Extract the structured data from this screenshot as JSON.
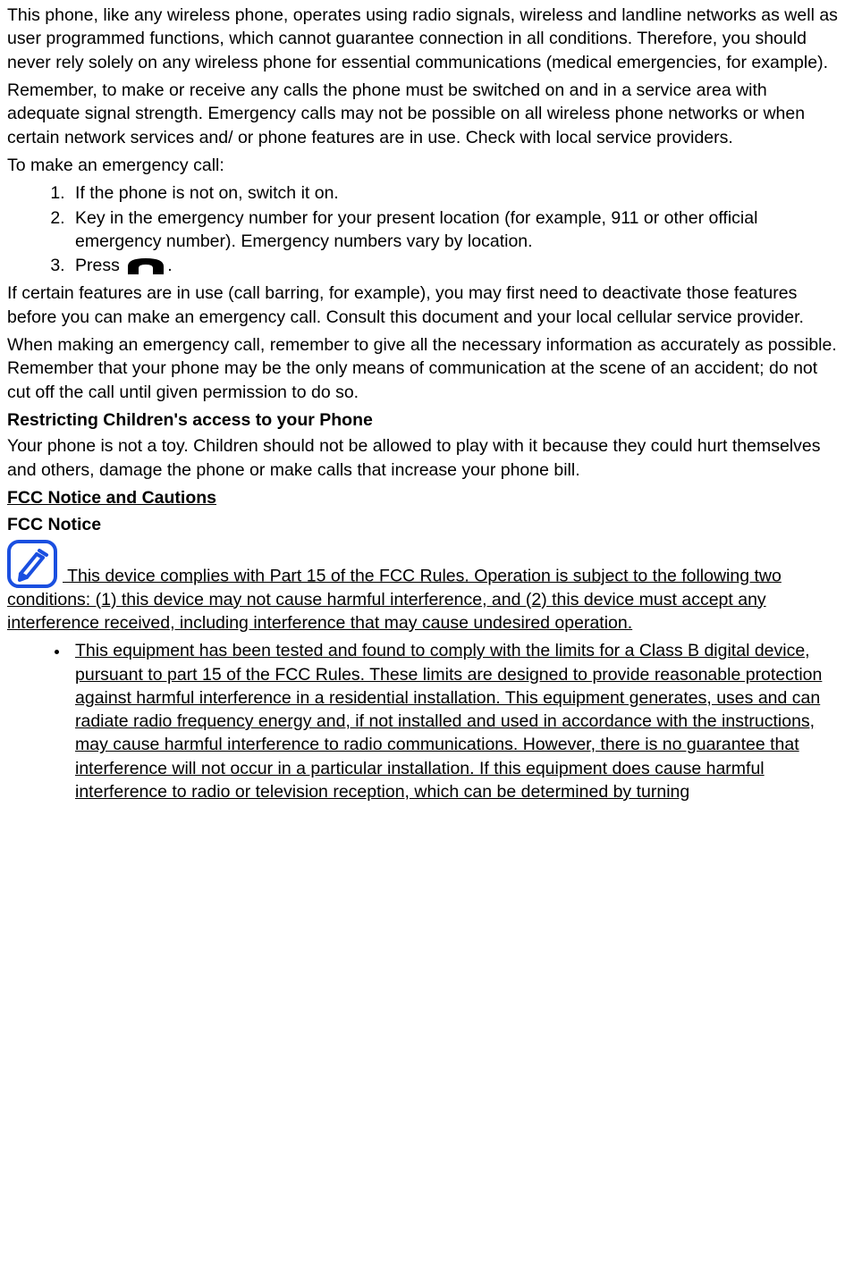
{
  "para1": "This phone, like any wireless phone, operates using radio signals, wireless and landline networks as well as user programmed functions, which cannot guarantee connection in all conditions. Therefore, you should never rely solely on any wireless phone for essential communications (medical emergencies, for example).",
  "para2": "Remember, to make or receive any calls the phone must be switched on and in a service area with adequate signal strength. Emergency calls may not be possible on all wireless phone networks or when certain network services and/ or phone features are in use. Check with local service providers.",
  "para3": "To make an emergency call:",
  "steps": [
    "If the phone is not on, switch it on.",
    "Key in the emergency number for your present location (for example, 911 or other official emergency number). Emergency numbers vary by location."
  ],
  "step3_prefix": "Press ",
  "step3_suffix": ".",
  "para4": "If certain features are in use (call barring, for example), you may first need to deactivate those features before you can make an emergency call. Consult this document and your local cellular service provider.",
  "para5": "When making an emergency call, remember to give all the necessary information as accurately as possible. Remember that your phone may be the only means of communication at the scene of an accident; do not cut off the call until given permission to do so.",
  "heading1": "Restricting Children's access to your Phone",
  "para6": "Your phone is not a toy. Children should not be allowed to play with it because they could hurt themselves and others, damage the phone or make calls that increase your phone bill.",
  "heading2": "FCC Notice and Cautions",
  "heading3": "FCC Notice",
  "fcc_note": " This device complies with Part 15 of the FCC Rules. Operation is subject to the following two conditions: (1) this device may not cause harmful interference, and (2) this device must accept any interference received, including interference that may cause undesired operation.",
  "bullet1": "This equipment has been tested and found to comply with the limits for a Class B digital device, pursuant to part 15 of the FCC Rules. These limits are designed to provide reasonable protection against harmful interference in a residential installation. This equipment generates, uses and can radiate radio frequency energy and, if not installed and used in accordance with the instructions, may cause harmful interference to radio communications. However, there is no guarantee that interference will not occur in a particular installation. If this equipment does cause harmful interference to radio or television reception, which can be determined by turning"
}
